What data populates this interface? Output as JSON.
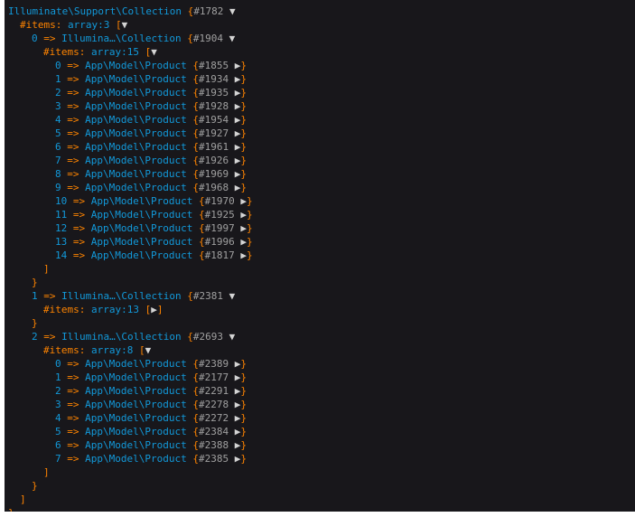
{
  "lines": [
    {
      "indent": 0,
      "segs": [
        {
          "t": "Illuminate\\Support\\Collection",
          "c": "cls"
        },
        {
          "t": " {",
          "c": "op"
        },
        {
          "t": "#1782",
          "c": "ref"
        },
        {
          "t": " ▼",
          "c": "arrow",
          "i": true
        }
      ]
    },
    {
      "indent": 1,
      "segs": [
        {
          "t": "#items",
          "c": "op"
        },
        {
          "t": ": ",
          "c": "op"
        },
        {
          "t": "array:3",
          "c": "cls"
        },
        {
          "t": " [",
          "c": "op"
        },
        {
          "t": "▼",
          "c": "arrow",
          "i": true
        }
      ]
    },
    {
      "indent": 2,
      "segs": [
        {
          "t": "0",
          "c": "num"
        },
        {
          "t": " => ",
          "c": "op"
        },
        {
          "t": "Illumina…\\Collection",
          "c": "cls"
        },
        {
          "t": " {",
          "c": "op"
        },
        {
          "t": "#1904",
          "c": "ref"
        },
        {
          "t": " ▼",
          "c": "arrow",
          "i": true
        }
      ]
    },
    {
      "indent": 3,
      "segs": [
        {
          "t": "#items",
          "c": "op"
        },
        {
          "t": ": ",
          "c": "op"
        },
        {
          "t": "array:15",
          "c": "cls"
        },
        {
          "t": " [",
          "c": "op"
        },
        {
          "t": "▼",
          "c": "arrow",
          "i": true
        }
      ]
    },
    {
      "indent": 4,
      "segs": [
        {
          "t": "0",
          "c": "num"
        },
        {
          "t": " => ",
          "c": "op"
        },
        {
          "t": "App\\Model\\Product",
          "c": "cls"
        },
        {
          "t": " {",
          "c": "op"
        },
        {
          "t": "#1855",
          "c": "ref"
        },
        {
          "t": " ▶",
          "c": "arrow",
          "i": true
        },
        {
          "t": "}",
          "c": "op"
        }
      ]
    },
    {
      "indent": 4,
      "segs": [
        {
          "t": "1",
          "c": "num"
        },
        {
          "t": " => ",
          "c": "op"
        },
        {
          "t": "App\\Model\\Product",
          "c": "cls"
        },
        {
          "t": " {",
          "c": "op"
        },
        {
          "t": "#1934",
          "c": "ref"
        },
        {
          "t": " ▶",
          "c": "arrow",
          "i": true
        },
        {
          "t": "}",
          "c": "op"
        }
      ]
    },
    {
      "indent": 4,
      "segs": [
        {
          "t": "2",
          "c": "num"
        },
        {
          "t": " => ",
          "c": "op"
        },
        {
          "t": "App\\Model\\Product",
          "c": "cls"
        },
        {
          "t": " {",
          "c": "op"
        },
        {
          "t": "#1935",
          "c": "ref"
        },
        {
          "t": " ▶",
          "c": "arrow",
          "i": true
        },
        {
          "t": "}",
          "c": "op"
        }
      ]
    },
    {
      "indent": 4,
      "segs": [
        {
          "t": "3",
          "c": "num"
        },
        {
          "t": " => ",
          "c": "op"
        },
        {
          "t": "App\\Model\\Product",
          "c": "cls"
        },
        {
          "t": " {",
          "c": "op"
        },
        {
          "t": "#1928",
          "c": "ref"
        },
        {
          "t": " ▶",
          "c": "arrow",
          "i": true
        },
        {
          "t": "}",
          "c": "op"
        }
      ]
    },
    {
      "indent": 4,
      "segs": [
        {
          "t": "4",
          "c": "num"
        },
        {
          "t": " => ",
          "c": "op"
        },
        {
          "t": "App\\Model\\Product",
          "c": "cls"
        },
        {
          "t": " {",
          "c": "op"
        },
        {
          "t": "#1954",
          "c": "ref"
        },
        {
          "t": " ▶",
          "c": "arrow",
          "i": true
        },
        {
          "t": "}",
          "c": "op"
        }
      ]
    },
    {
      "indent": 4,
      "segs": [
        {
          "t": "5",
          "c": "num"
        },
        {
          "t": " => ",
          "c": "op"
        },
        {
          "t": "App\\Model\\Product",
          "c": "cls"
        },
        {
          "t": " {",
          "c": "op"
        },
        {
          "t": "#1927",
          "c": "ref"
        },
        {
          "t": " ▶",
          "c": "arrow",
          "i": true
        },
        {
          "t": "}",
          "c": "op"
        }
      ]
    },
    {
      "indent": 4,
      "segs": [
        {
          "t": "6",
          "c": "num"
        },
        {
          "t": " => ",
          "c": "op"
        },
        {
          "t": "App\\Model\\Product",
          "c": "cls"
        },
        {
          "t": " {",
          "c": "op"
        },
        {
          "t": "#1961",
          "c": "ref"
        },
        {
          "t": " ▶",
          "c": "arrow",
          "i": true
        },
        {
          "t": "}",
          "c": "op"
        }
      ]
    },
    {
      "indent": 4,
      "segs": [
        {
          "t": "7",
          "c": "num"
        },
        {
          "t": " => ",
          "c": "op"
        },
        {
          "t": "App\\Model\\Product",
          "c": "cls"
        },
        {
          "t": " {",
          "c": "op"
        },
        {
          "t": "#1926",
          "c": "ref"
        },
        {
          "t": " ▶",
          "c": "arrow",
          "i": true
        },
        {
          "t": "}",
          "c": "op"
        }
      ]
    },
    {
      "indent": 4,
      "segs": [
        {
          "t": "8",
          "c": "num"
        },
        {
          "t": " => ",
          "c": "op"
        },
        {
          "t": "App\\Model\\Product",
          "c": "cls"
        },
        {
          "t": " {",
          "c": "op"
        },
        {
          "t": "#1969",
          "c": "ref"
        },
        {
          "t": " ▶",
          "c": "arrow",
          "i": true
        },
        {
          "t": "}",
          "c": "op"
        }
      ]
    },
    {
      "indent": 4,
      "segs": [
        {
          "t": "9",
          "c": "num"
        },
        {
          "t": " => ",
          "c": "op"
        },
        {
          "t": "App\\Model\\Product",
          "c": "cls"
        },
        {
          "t": " {",
          "c": "op"
        },
        {
          "t": "#1968",
          "c": "ref"
        },
        {
          "t": " ▶",
          "c": "arrow",
          "i": true
        },
        {
          "t": "}",
          "c": "op"
        }
      ]
    },
    {
      "indent": 4,
      "segs": [
        {
          "t": "10",
          "c": "num"
        },
        {
          "t": " => ",
          "c": "op"
        },
        {
          "t": "App\\Model\\Product",
          "c": "cls"
        },
        {
          "t": " {",
          "c": "op"
        },
        {
          "t": "#1970",
          "c": "ref"
        },
        {
          "t": " ▶",
          "c": "arrow",
          "i": true
        },
        {
          "t": "}",
          "c": "op"
        }
      ]
    },
    {
      "indent": 4,
      "segs": [
        {
          "t": "11",
          "c": "num"
        },
        {
          "t": " => ",
          "c": "op"
        },
        {
          "t": "App\\Model\\Product",
          "c": "cls"
        },
        {
          "t": " {",
          "c": "op"
        },
        {
          "t": "#1925",
          "c": "ref"
        },
        {
          "t": " ▶",
          "c": "arrow",
          "i": true
        },
        {
          "t": "}",
          "c": "op"
        }
      ]
    },
    {
      "indent": 4,
      "segs": [
        {
          "t": "12",
          "c": "num"
        },
        {
          "t": " => ",
          "c": "op"
        },
        {
          "t": "App\\Model\\Product",
          "c": "cls"
        },
        {
          "t": " {",
          "c": "op"
        },
        {
          "t": "#1997",
          "c": "ref"
        },
        {
          "t": " ▶",
          "c": "arrow",
          "i": true
        },
        {
          "t": "}",
          "c": "op"
        }
      ]
    },
    {
      "indent": 4,
      "segs": [
        {
          "t": "13",
          "c": "num"
        },
        {
          "t": " => ",
          "c": "op"
        },
        {
          "t": "App\\Model\\Product",
          "c": "cls"
        },
        {
          "t": " {",
          "c": "op"
        },
        {
          "t": "#1996",
          "c": "ref"
        },
        {
          "t": " ▶",
          "c": "arrow",
          "i": true
        },
        {
          "t": "}",
          "c": "op"
        }
      ]
    },
    {
      "indent": 4,
      "segs": [
        {
          "t": "14",
          "c": "num"
        },
        {
          "t": " => ",
          "c": "op"
        },
        {
          "t": "App\\Model\\Product",
          "c": "cls"
        },
        {
          "t": " {",
          "c": "op"
        },
        {
          "t": "#1817",
          "c": "ref"
        },
        {
          "t": " ▶",
          "c": "arrow",
          "i": true
        },
        {
          "t": "}",
          "c": "op"
        }
      ]
    },
    {
      "indent": 3,
      "segs": [
        {
          "t": "]",
          "c": "op"
        }
      ]
    },
    {
      "indent": 2,
      "segs": [
        {
          "t": "}",
          "c": "op"
        }
      ]
    },
    {
      "indent": 2,
      "segs": [
        {
          "t": "1",
          "c": "num"
        },
        {
          "t": " => ",
          "c": "op"
        },
        {
          "t": "Illumina…\\Collection",
          "c": "cls"
        },
        {
          "t": " {",
          "c": "op"
        },
        {
          "t": "#2381",
          "c": "ref"
        },
        {
          "t": " ▼",
          "c": "arrow",
          "i": true
        }
      ]
    },
    {
      "indent": 3,
      "segs": [
        {
          "t": "#items",
          "c": "op"
        },
        {
          "t": ": ",
          "c": "op"
        },
        {
          "t": "array:13",
          "c": "cls"
        },
        {
          "t": " [",
          "c": "op"
        },
        {
          "t": "▶",
          "c": "arrow",
          "i": true
        },
        {
          "t": "]",
          "c": "op"
        }
      ]
    },
    {
      "indent": 2,
      "segs": [
        {
          "t": "}",
          "c": "op"
        }
      ]
    },
    {
      "indent": 2,
      "segs": [
        {
          "t": "2",
          "c": "num"
        },
        {
          "t": " => ",
          "c": "op"
        },
        {
          "t": "Illumina…\\Collection",
          "c": "cls"
        },
        {
          "t": " {",
          "c": "op"
        },
        {
          "t": "#2693",
          "c": "ref"
        },
        {
          "t": " ▼",
          "c": "arrow",
          "i": true
        }
      ]
    },
    {
      "indent": 3,
      "segs": [
        {
          "t": "#items",
          "c": "op"
        },
        {
          "t": ": ",
          "c": "op"
        },
        {
          "t": "array:8",
          "c": "cls"
        },
        {
          "t": " [",
          "c": "op"
        },
        {
          "t": "▼",
          "c": "arrow",
          "i": true
        }
      ]
    },
    {
      "indent": 4,
      "segs": [
        {
          "t": "0",
          "c": "num"
        },
        {
          "t": " => ",
          "c": "op"
        },
        {
          "t": "App\\Model\\Product",
          "c": "cls"
        },
        {
          "t": " {",
          "c": "op"
        },
        {
          "t": "#2389",
          "c": "ref"
        },
        {
          "t": " ▶",
          "c": "arrow",
          "i": true
        },
        {
          "t": "}",
          "c": "op"
        }
      ]
    },
    {
      "indent": 4,
      "segs": [
        {
          "t": "1",
          "c": "num"
        },
        {
          "t": " => ",
          "c": "op"
        },
        {
          "t": "App\\Model\\Product",
          "c": "cls"
        },
        {
          "t": " {",
          "c": "op"
        },
        {
          "t": "#2177",
          "c": "ref"
        },
        {
          "t": " ▶",
          "c": "arrow",
          "i": true
        },
        {
          "t": "}",
          "c": "op"
        }
      ]
    },
    {
      "indent": 4,
      "segs": [
        {
          "t": "2",
          "c": "num"
        },
        {
          "t": " => ",
          "c": "op"
        },
        {
          "t": "App\\Model\\Product",
          "c": "cls"
        },
        {
          "t": " {",
          "c": "op"
        },
        {
          "t": "#2291",
          "c": "ref"
        },
        {
          "t": " ▶",
          "c": "arrow",
          "i": true
        },
        {
          "t": "}",
          "c": "op"
        }
      ]
    },
    {
      "indent": 4,
      "segs": [
        {
          "t": "3",
          "c": "num"
        },
        {
          "t": " => ",
          "c": "op"
        },
        {
          "t": "App\\Model\\Product",
          "c": "cls"
        },
        {
          "t": " {",
          "c": "op"
        },
        {
          "t": "#2278",
          "c": "ref"
        },
        {
          "t": " ▶",
          "c": "arrow",
          "i": true
        },
        {
          "t": "}",
          "c": "op"
        }
      ]
    },
    {
      "indent": 4,
      "segs": [
        {
          "t": "4",
          "c": "num"
        },
        {
          "t": " => ",
          "c": "op"
        },
        {
          "t": "App\\Model\\Product",
          "c": "cls"
        },
        {
          "t": " {",
          "c": "op"
        },
        {
          "t": "#2272",
          "c": "ref"
        },
        {
          "t": " ▶",
          "c": "arrow",
          "i": true
        },
        {
          "t": "}",
          "c": "op"
        }
      ]
    },
    {
      "indent": 4,
      "segs": [
        {
          "t": "5",
          "c": "num"
        },
        {
          "t": " => ",
          "c": "op"
        },
        {
          "t": "App\\Model\\Product",
          "c": "cls"
        },
        {
          "t": " {",
          "c": "op"
        },
        {
          "t": "#2384",
          "c": "ref"
        },
        {
          "t": " ▶",
          "c": "arrow",
          "i": true
        },
        {
          "t": "}",
          "c": "op"
        }
      ]
    },
    {
      "indent": 4,
      "segs": [
        {
          "t": "6",
          "c": "num"
        },
        {
          "t": " => ",
          "c": "op"
        },
        {
          "t": "App\\Model\\Product",
          "c": "cls"
        },
        {
          "t": " {",
          "c": "op"
        },
        {
          "t": "#2388",
          "c": "ref"
        },
        {
          "t": " ▶",
          "c": "arrow",
          "i": true
        },
        {
          "t": "}",
          "c": "op"
        }
      ]
    },
    {
      "indent": 4,
      "segs": [
        {
          "t": "7",
          "c": "num"
        },
        {
          "t": " => ",
          "c": "op"
        },
        {
          "t": "App\\Model\\Product",
          "c": "cls"
        },
        {
          "t": " {",
          "c": "op"
        },
        {
          "t": "#2385",
          "c": "ref"
        },
        {
          "t": " ▶",
          "c": "arrow",
          "i": true
        },
        {
          "t": "}",
          "c": "op"
        }
      ]
    },
    {
      "indent": 3,
      "segs": [
        {
          "t": "]",
          "c": "op"
        }
      ]
    },
    {
      "indent": 2,
      "segs": [
        {
          "t": "}",
          "c": "op"
        }
      ]
    },
    {
      "indent": 1,
      "segs": [
        {
          "t": "]",
          "c": "op"
        }
      ]
    },
    {
      "indent": 0,
      "segs": [
        {
          "t": "}",
          "c": "op"
        }
      ]
    }
  ],
  "colors": {
    "background": "#18171b",
    "class": "#1299da",
    "operator": "#ff8400",
    "ref": "#a0a0a0",
    "arrow": "#d4d4d4"
  }
}
